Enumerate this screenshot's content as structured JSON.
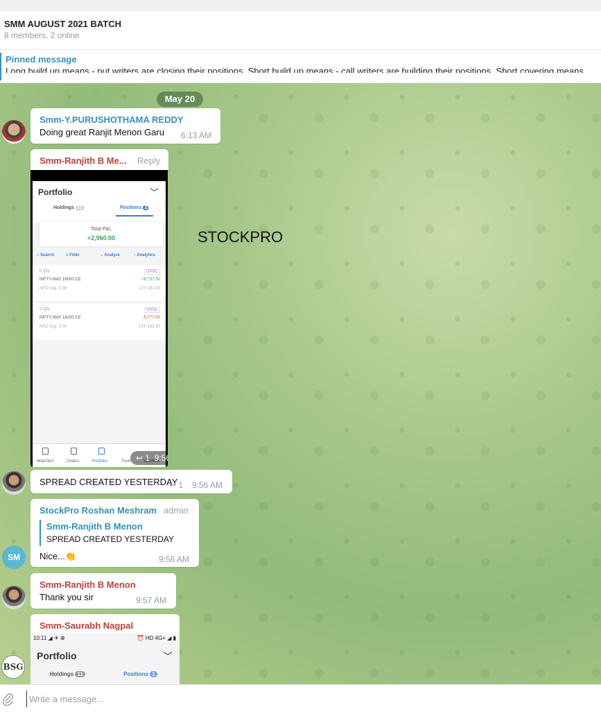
{
  "header": {
    "title": "SMM AUGUST 2021 BATCH",
    "subtitle": "8 members, 2 online"
  },
  "pinned": {
    "title": "Pinned message",
    "text": "Long build up means - put writers are closing their positions. Short build up means - call writers are building their positions. Short covering means"
  },
  "chat": {
    "date_pill": "May 20",
    "watermark": "STOCKPRO",
    "messages": [
      {
        "sender": "Smm-Y.PURUSHOTHAMA REDDY",
        "text": "Doing great Ranjit Menon Garu",
        "time": "6:13 AM"
      },
      {
        "sender": "Smm-Ranjith B Me...",
        "reply_label": "Reply",
        "time": "9:56 AM",
        "replies": "1"
      },
      {
        "text": "SPREAD CREATED YESTERDAY",
        "replies": "1",
        "time": "9:56 AM"
      },
      {
        "sender": "StockPro Roshan Meshram",
        "role": "admin",
        "quote_name": "Smm-Ranjith B Menon",
        "quote_text": "SPREAD CREATED YESTERDAY",
        "text": "Nice...👏",
        "time": "9:56 AM",
        "avatar_initials": "SM"
      },
      {
        "sender": "Smm-Ranjith B Menon",
        "text": "Thank you sir",
        "time": "9:57 AM"
      },
      {
        "sender": "Smm-Saurabh Nagpal",
        "avatar_initials": "BSG"
      }
    ]
  },
  "shot1": {
    "title": "Portfolio",
    "tab_holdings": "Holdings",
    "holdings_count": "22",
    "tab_positions": "Positions",
    "positions_count": "2",
    "pnl_label": "Total P&L",
    "pnl_value": "+2,960.00",
    "tools": [
      "Search",
      "Filter",
      "Analyze",
      "Analytics"
    ],
    "positions": [
      {
        "qty": "0 Qty",
        "tag": "NRML",
        "name": "NIFTY MAY 16000 CE",
        "pnl": "+8,737.50",
        "exch": "NFO  Avg. 0.00",
        "ltp": "LTP 281.00"
      },
      {
        "qty": "0 Qty",
        "tag": "NRML",
        "name": "NIFTY MAY 16200 CE",
        "pnl": "-5,777.50",
        "exch": "NFO  Avg. 0.00",
        "ltp": "LTP 163.30"
      }
    ],
    "nav": [
      "Watchlist",
      "Orders",
      "Portfolio",
      "Tools",
      "WA0574"
    ]
  },
  "shot2": {
    "status_left": "10:11 ◢ ✈ ⊕ ",
    "status_right": "⏰ HD 4G+ ◢ ▮",
    "title": "Portfolio",
    "tab_holdings": "Holdings",
    "holdings_count": "11",
    "tab_positions": "Positions",
    "positions_count": "1"
  },
  "composer": {
    "placeholder": "Write a message..."
  },
  "colors": {
    "accent": "#3a8fd0",
    "red_name": "#c0403c",
    "green": "#3aa35a"
  }
}
